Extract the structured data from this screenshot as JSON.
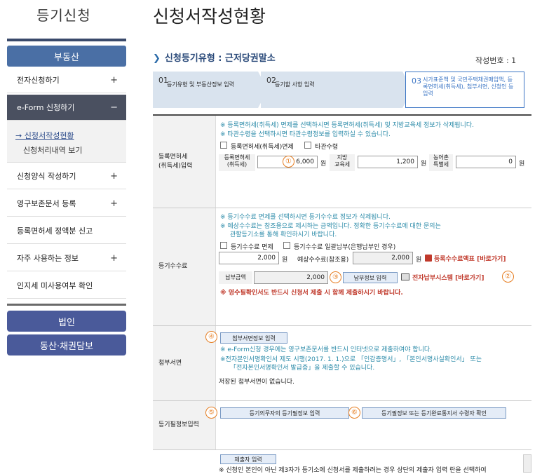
{
  "sidebar": {
    "title": "등기신청",
    "section": "부동산",
    "items": [
      {
        "label": "전자신청하기",
        "pm": "+"
      },
      {
        "label": "e-Form 신청하기",
        "pm": "−"
      },
      {
        "label": "신청양식 작성하기",
        "pm": "+"
      },
      {
        "label": "영구보존문서 등록",
        "pm": "+"
      },
      {
        "label": "등록면허세 정액분 신고",
        "pm": ""
      },
      {
        "label": "자주 사용하는 정보",
        "pm": "+"
      },
      {
        "label": "인지세 미사용여부 확인",
        "pm": ""
      }
    ],
    "sub_items": [
      "→ 신청서작성현황",
      "신청처리내역 보기"
    ],
    "corp_buttons": [
      "법인",
      "동산·채권담보"
    ]
  },
  "main": {
    "title": "신청서작성현황",
    "reg_type": "신청등기유형 : 근저당권말소",
    "doc_no": "작성번호 : 1",
    "steps": [
      {
        "num": "01",
        "text": "등기유형 및 부동산정보 입력"
      },
      {
        "num": "02",
        "text": "등기할 사항 입력"
      },
      {
        "num": "03",
        "text": "시가표준액 및 국민주택채권매입액, 등록면허세(취득세), 첨부서면, 신청인 등 입력"
      }
    ]
  },
  "form": {
    "reg_tax": {
      "label": "등록면허세\n(취득세)입력",
      "notes": [
        "※ 등록면허세(취득세) 면제를 선택하시면 등록면허세(취득세) 및 지방교육세 정보가 삭제됩니다.",
        "※ 타관수령을 선택하시면 타관수령정보를 입력하실 수 있습니다."
      ],
      "check_exempt": "등록면허세(취득세)면제",
      "check_other": "타관수령",
      "field1_label": "등록면허세\n(취득세)",
      "field1_value": "6,000",
      "field2_label": "지방\n교육세",
      "field2_value": "1,200",
      "field3_label": "농어촌\n특별세",
      "field3_value": "0",
      "unit": "원",
      "badge": "①"
    },
    "fee": {
      "label": "등기수수료",
      "notes": [
        "※ 등기수수료 면제를 선택하시면 등기수수료 정보가 삭제됩니다.",
        "※ 예상수수료는 참조용으로 제시하는 금액입니다. 정확한 등기수수료에 대한 문의는",
        "관할등기소를 통해 확인하시기 바랍니다."
      ],
      "check_exempt": "등기수수료 면제",
      "check_batch": "등기수수료 일괄납부(은행납부인 경우)",
      "amount": "2,000",
      "unit": "원",
      "expected_label": "예상수수료(참조용)",
      "expected_value": "2,000",
      "fee_table_link": "등록수수료액표 [바로가기]",
      "paid_label": "납부금액",
      "paid_value": "2,000",
      "pay_info_button": "납부정보 입력",
      "epay_link": "전자납부시스템 [바로가기]",
      "warning": "※ 영수필확인서도 반드시 신청서 제출 시 함께 제출하시기 바랍니다.",
      "badge3": "③",
      "badge2": "②"
    },
    "attach": {
      "label": "첨부서면",
      "button": "첨부서면정보 입력",
      "notes": [
        "※ e-Form신청 경우에는 영구보존문서를 반드시 인터넷으로 제출하여야 합니다.",
        "※전자본인서명확인서 제도 시행(2017. 1. 1.)으로 「인감증명서」, 「본인서명사실확인서」 또는",
        "「전자본인서명확인서 발급증」을 제출할 수 있습니다."
      ],
      "saved": "저장된 첨부서면이 없습니다.",
      "badge": "④"
    },
    "required": {
      "label": "등기필정보입력",
      "button1": "등기의무자의 등기필정보 입력",
      "button2": "등기필정보 또는 등기완료통지서 수령자 확인",
      "badge5": "⑤",
      "badge6": "⑥"
    },
    "submitter": {
      "button": "제출자 입력",
      "note": "※ 신청인 본인이 아닌 제3자가 등기소에 신청서를 제출하려는 경우 상단의 제출자 입력 란을 선택하여"
    }
  }
}
